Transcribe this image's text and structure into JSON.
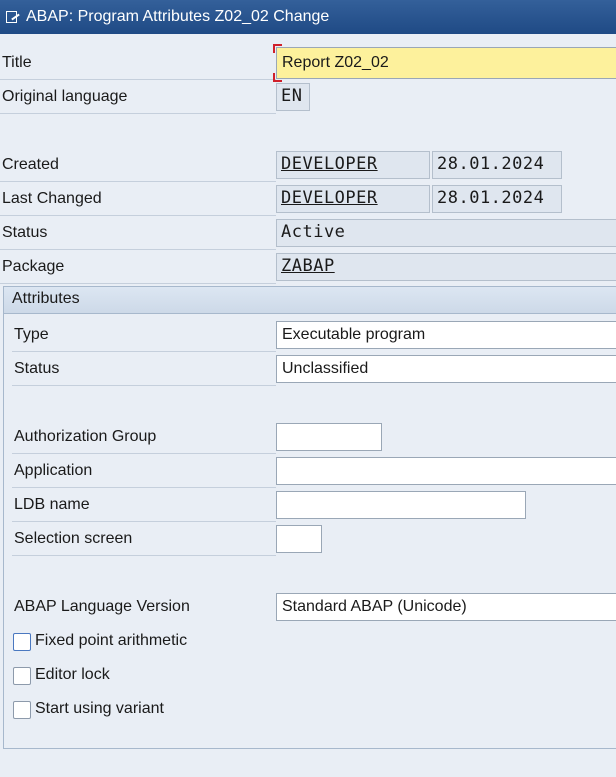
{
  "window": {
    "title": "ABAP: Program Attributes Z02_02 Change",
    "icon": "edit-document-icon"
  },
  "header": {
    "title_label": "Title",
    "title_value": "Report Z02_02",
    "orig_lang_label": "Original language",
    "orig_lang_value": "EN",
    "created_label": "Created",
    "created_user": "DEVELOPER",
    "created_date": "28.01.2024",
    "changed_label": "Last Changed",
    "changed_user": "DEVELOPER",
    "changed_date": "28.01.2024",
    "status_label": "Status",
    "status_value": "Active",
    "package_label": "Package",
    "package_value": "ZABAP"
  },
  "attributes": {
    "group_title": "Attributes",
    "type_label": "Type",
    "type_value": "Executable program",
    "status_label": "Status",
    "status_value": "Unclassified",
    "auth_group_label": "Authorization Group",
    "auth_group_value": "",
    "application_label": "Application",
    "application_value": "",
    "ldb_label": "LDB name",
    "ldb_value": "",
    "selscreen_label": "Selection screen",
    "selscreen_value": "",
    "abap_version_label": "ABAP Language Version",
    "abap_version_value": "Standard ABAP (Unicode)",
    "checkboxes": [
      {
        "label": "Fixed point arithmetic",
        "checked": false
      },
      {
        "label": "Editor lock",
        "checked": false
      },
      {
        "label": "Start using variant",
        "checked": false
      }
    ]
  },
  "colors": {
    "titlebar": "#1f4a85",
    "required_mark": "#d0202a",
    "highlight_field": "#fdf19c"
  }
}
